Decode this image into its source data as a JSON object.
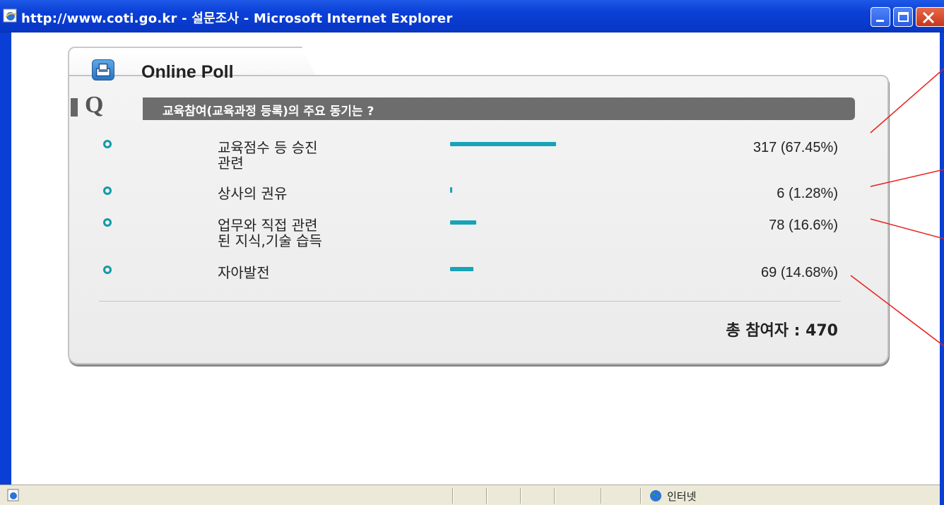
{
  "window": {
    "title": "http://www.coti.go.kr - 설문조사 - Microsoft Internet Explorer",
    "minimize_label": "_",
    "maximize_label": "□",
    "close_label": "✕"
  },
  "poll": {
    "title": "Online Poll",
    "q_letter": "Q",
    "question": "교육참여(교육과정 등록)의 주요 동기는 ?",
    "options": [
      {
        "label": "교육점수 등 승진\n관련",
        "count": 317,
        "percent": 67.45,
        "value_text": "317 (67.45%)"
      },
      {
        "label": "상사의 권유",
        "count": 6,
        "percent": 1.28,
        "value_text": "6 (1.28%)"
      },
      {
        "label": "업무와 직접 관련\n된 지식,기술 습득",
        "count": 78,
        "percent": 16.6,
        "value_text": "78 (16.6%)"
      },
      {
        "label": "자아발전",
        "count": 69,
        "percent": 14.68,
        "value_text": "69 (14.68%)"
      }
    ],
    "total_text": "총 참여자 : 470",
    "bar_color": "#18a3b8"
  },
  "statusbar": {
    "zone_label": "인터넷"
  },
  "colors": {
    "titlebar": "#0a3fd6",
    "question_bar": "#6d6d6d",
    "annotation_line": "#e8201e"
  }
}
